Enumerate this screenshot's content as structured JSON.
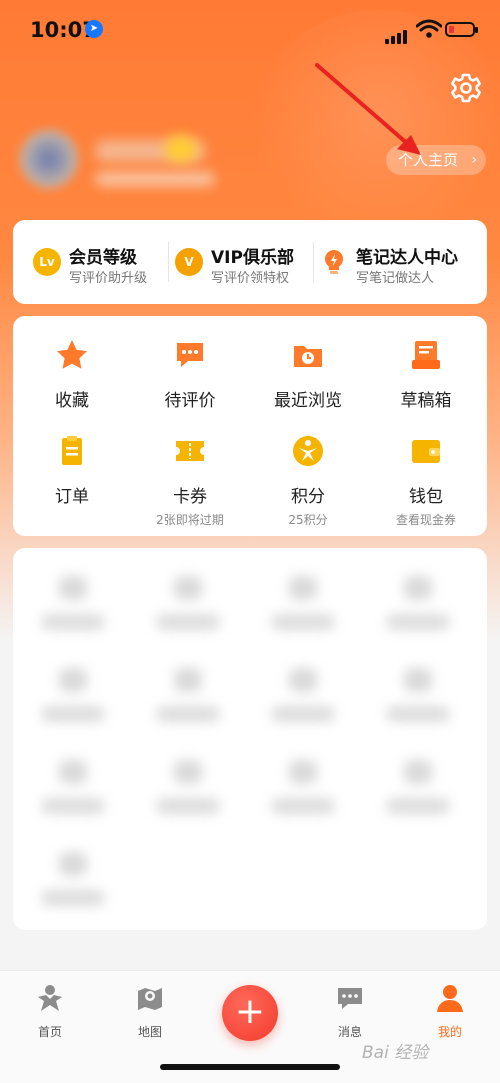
{
  "status_bar": {
    "time": "10:07"
  },
  "profile": {
    "home_button": "个人主页",
    "home_chevron": "›"
  },
  "member_card": [
    {
      "icon": "Lv",
      "icon_color": "#f5b400",
      "title": "会员等级",
      "subtitle": "写评价助升级"
    },
    {
      "icon": "V",
      "icon_color": "#f5a100",
      "title": "VIP俱乐部",
      "subtitle": "写评价领特权"
    },
    {
      "icon": "bulb-icon",
      "icon_color": "#ff7a2a",
      "title": "笔记达人中心",
      "subtitle": "写笔记做达人"
    }
  ],
  "grid": [
    {
      "label": "收藏",
      "sub": "",
      "icon": "star-icon",
      "color": "#ff7a2a"
    },
    {
      "label": "待评价",
      "sub": "",
      "icon": "comment-icon",
      "color": "#ff7a2a"
    },
    {
      "label": "最近浏览",
      "sub": "",
      "icon": "history-folder-icon",
      "color": "#ff7a2a"
    },
    {
      "label": "草稿箱",
      "sub": "",
      "icon": "draft-box-icon",
      "color": "#ff7a2a"
    },
    {
      "label": "订单",
      "sub": "",
      "icon": "order-icon",
      "color": "#f5b400"
    },
    {
      "label": "卡券",
      "sub": "2张即将过期",
      "icon": "coupon-icon",
      "color": "#f5b400"
    },
    {
      "label": "积分",
      "sub": "25积分",
      "icon": "points-icon",
      "color": "#f5b400"
    },
    {
      "label": "钱包",
      "sub": "查看现金券",
      "icon": "wallet-icon",
      "color": "#f5b400"
    }
  ],
  "tabbar": [
    {
      "label": "首页",
      "icon": "home-person-icon",
      "active": false
    },
    {
      "label": "地图",
      "icon": "map-icon",
      "active": false
    },
    {
      "label": "消息",
      "icon": "message-icon",
      "active": false
    },
    {
      "label": "我的",
      "icon": "profile-icon",
      "active": true
    }
  ],
  "watermark": "Bai 经验",
  "accent_color": "#ff7a2a"
}
